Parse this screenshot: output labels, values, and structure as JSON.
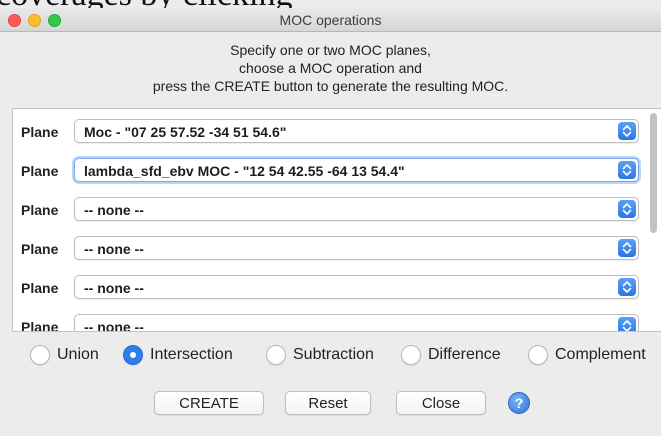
{
  "background": {
    "text": "coverages by clicking"
  },
  "window": {
    "title": "MOC operations"
  },
  "instructions": {
    "line1": "Specify one or two MOC planes,",
    "line2": "choose a MOC operation and",
    "line3": "press the CREATE button to generate the resulting MOC."
  },
  "planes": [
    {
      "label": "Plane",
      "value": "Moc - \"07 25 57.52 -34 51 54.6\""
    },
    {
      "label": "Plane",
      "value": "lambda_sfd_ebv MOC - \"12 54 42.55 -64 13 54.4\""
    },
    {
      "label": "Plane",
      "value": "-- none --"
    },
    {
      "label": "Plane",
      "value": "-- none --"
    },
    {
      "label": "Plane",
      "value": "-- none --"
    },
    {
      "label": "Plane",
      "value": "-- none --"
    }
  ],
  "operations": {
    "selected": "Intersection",
    "options": [
      {
        "label": "Union"
      },
      {
        "label": "Intersection"
      },
      {
        "label": "Subtraction"
      },
      {
        "label": "Difference"
      },
      {
        "label": "Complement"
      }
    ]
  },
  "buttons": {
    "create": "CREATE",
    "reset": "Reset",
    "close": "Close",
    "help": "?"
  },
  "colors": {
    "accent": "#2f7de9",
    "close_dot": "#fd5c56",
    "minimize_dot": "#fdbc2e",
    "zoom_dot": "#34c84a"
  },
  "icons": {
    "stepper": "chevron-up-down-icon",
    "help": "help-icon"
  }
}
